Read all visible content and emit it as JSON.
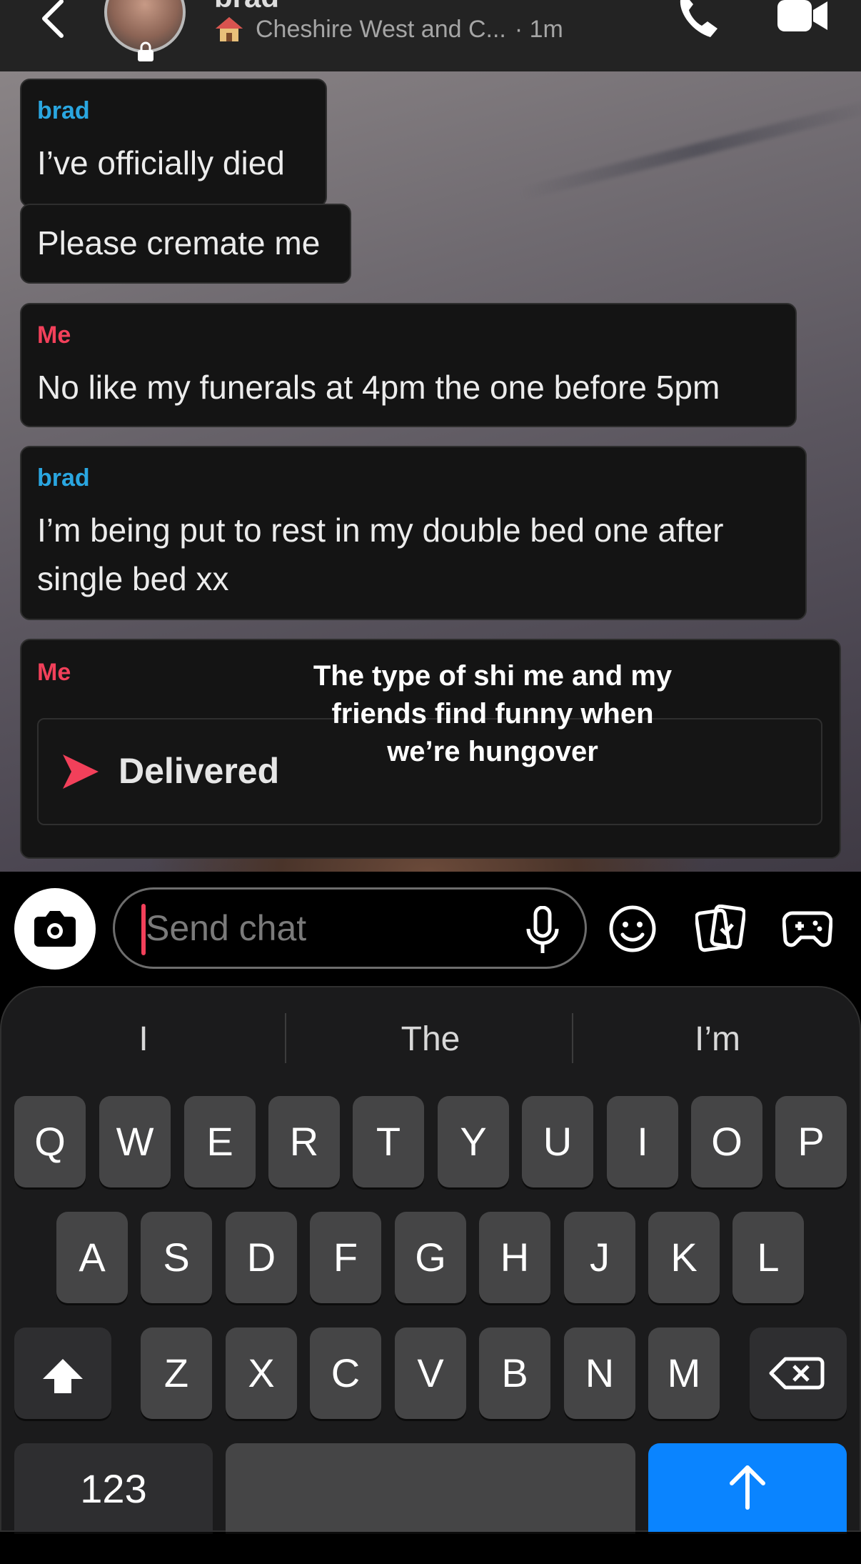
{
  "header": {
    "contact_name": "brad",
    "location": "Cheshire West and C...",
    "time_ago": "· 1m"
  },
  "messages": [
    {
      "sender": "brad",
      "lines": [
        "I’ve officially died"
      ]
    },
    {
      "sender": "",
      "lines": [
        "Please cremate me"
      ]
    },
    {
      "sender": "Me",
      "lines": [
        "No like my funerals at 4pm the one before 5pm"
      ]
    },
    {
      "sender": "brad",
      "lines": [
        "I’m being put to rest in my double bed one after",
        "single bed xx"
      ]
    },
    {
      "sender": "Me",
      "status": "Delivered"
    }
  ],
  "overlay_caption": [
    "The type of shi me and my",
    "friends find funny when",
    "we’re hungover"
  ],
  "chat_input": {
    "placeholder": "Send chat"
  },
  "suggestions": [
    "I",
    "The",
    "I’m"
  ],
  "keyboard": {
    "row1": [
      "Q",
      "W",
      "E",
      "R",
      "T",
      "Y",
      "U",
      "I",
      "O",
      "P"
    ],
    "row2": [
      "A",
      "S",
      "D",
      "F",
      "G",
      "H",
      "J",
      "K",
      "L"
    ],
    "row3": [
      "Z",
      "X",
      "C",
      "V",
      "B",
      "N",
      "M"
    ],
    "numbers_key": "123"
  },
  "colors": {
    "brad_name": "#2aa6e0",
    "me_name": "#f2405a",
    "send_key": "#0a84ff",
    "delivered_arrow": "#f2405a"
  },
  "icons": [
    "back-icon",
    "avatar",
    "lock-icon",
    "home-icon",
    "phone-icon",
    "video-icon",
    "camera-icon",
    "mic-icon",
    "emoji-icon",
    "sticker-icon",
    "game-controller-icon",
    "shift-icon",
    "delete-icon",
    "send-arrow-icon"
  ]
}
